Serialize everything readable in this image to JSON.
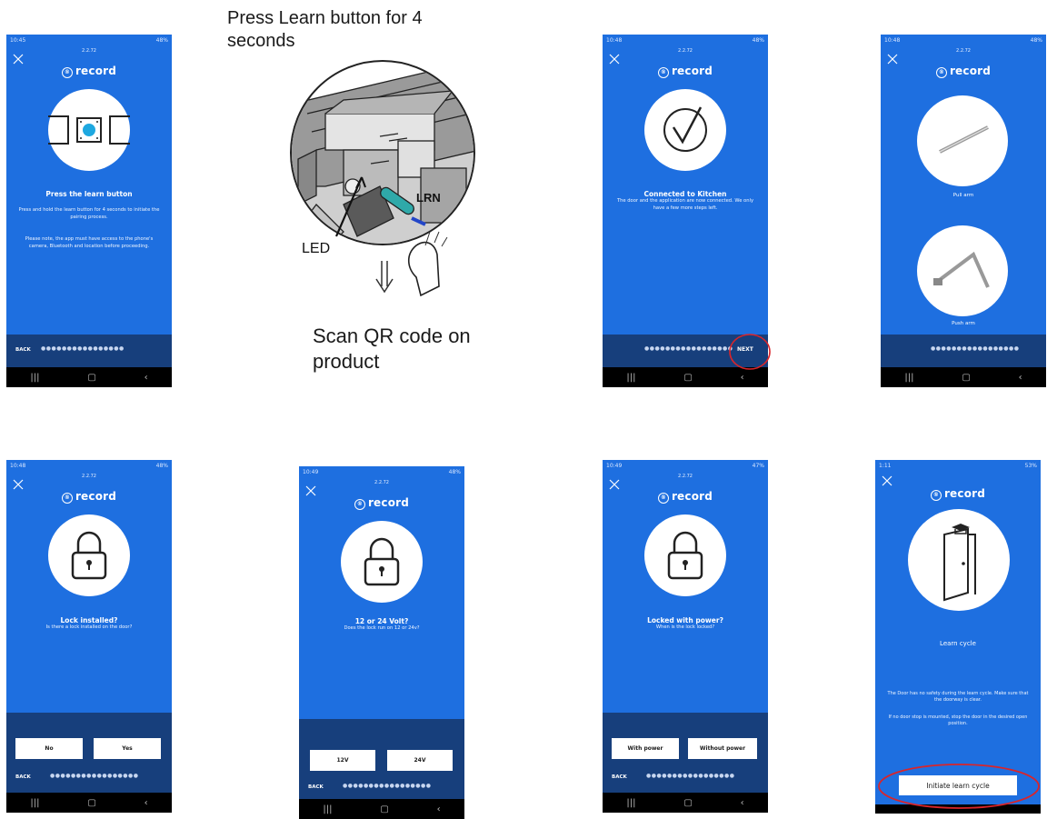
{
  "annotations": {
    "press_learn": "Press Learn button for 4 seconds",
    "scan_qr": "Scan QR code on product",
    "led": "LED",
    "lrn": "LRN"
  },
  "common": {
    "logo": "record",
    "version": "2.2.72",
    "back": "BACK",
    "accent": "#1e6fe0",
    "panel": "#173f7c"
  },
  "screens": {
    "learn": {
      "time": "10:45",
      "battery": "48%",
      "title": "Press the learn button",
      "body1": "Press and hold the learn button for 4 seconds to initiate the pairing process.",
      "body2": "Please note, the app must have access to the phone's camera, Bluetooth and location before proceeding.",
      "dots": "●●●●●●●●●●●●●●●●"
    },
    "connected": {
      "time": "10:48",
      "battery": "48%",
      "title": "Connected to Kitchen",
      "body": "The door and the application are now connected. We only have a few more steps left.",
      "next": "NEXT",
      "dots": "●●●●●●●●●●●●●●●●●"
    },
    "arm": {
      "time": "10:48",
      "battery": "48%",
      "pull": "Pull arm",
      "push": "Push arm",
      "dots": "●●●●●●●●●●●●●●●●●"
    },
    "lock": {
      "time": "10:48",
      "battery": "48%",
      "title": "Lock installed?",
      "sub": "Is there a lock installed on the door?",
      "no": "No",
      "yes": "Yes",
      "dots": "●●●●●●●●●●●●●●●●●"
    },
    "volt": {
      "time": "10:49",
      "battery": "48%",
      "title": "12 or 24 Volt?",
      "sub": "Does the lock run on 12 or 24v?",
      "v12": "12V",
      "v24": "24V",
      "dots": "●●●●●●●●●●●●●●●●●"
    },
    "power": {
      "time": "10:49",
      "battery": "47%",
      "title": "Locked with power?",
      "sub": "When is the lock locked?",
      "with": "With power",
      "without": "Without power",
      "dots": "●●●●●●●●●●●●●●●●●"
    },
    "cycle": {
      "time": "1:11",
      "battery": "53%",
      "title": "Learn cycle",
      "body1": "The Door has no safety during the learn cycle. Make sure that the doorway is clear.",
      "body2": "If no door stop is mounted, stop the door in the desired open position.",
      "button": "Initiate learn cycle"
    }
  }
}
